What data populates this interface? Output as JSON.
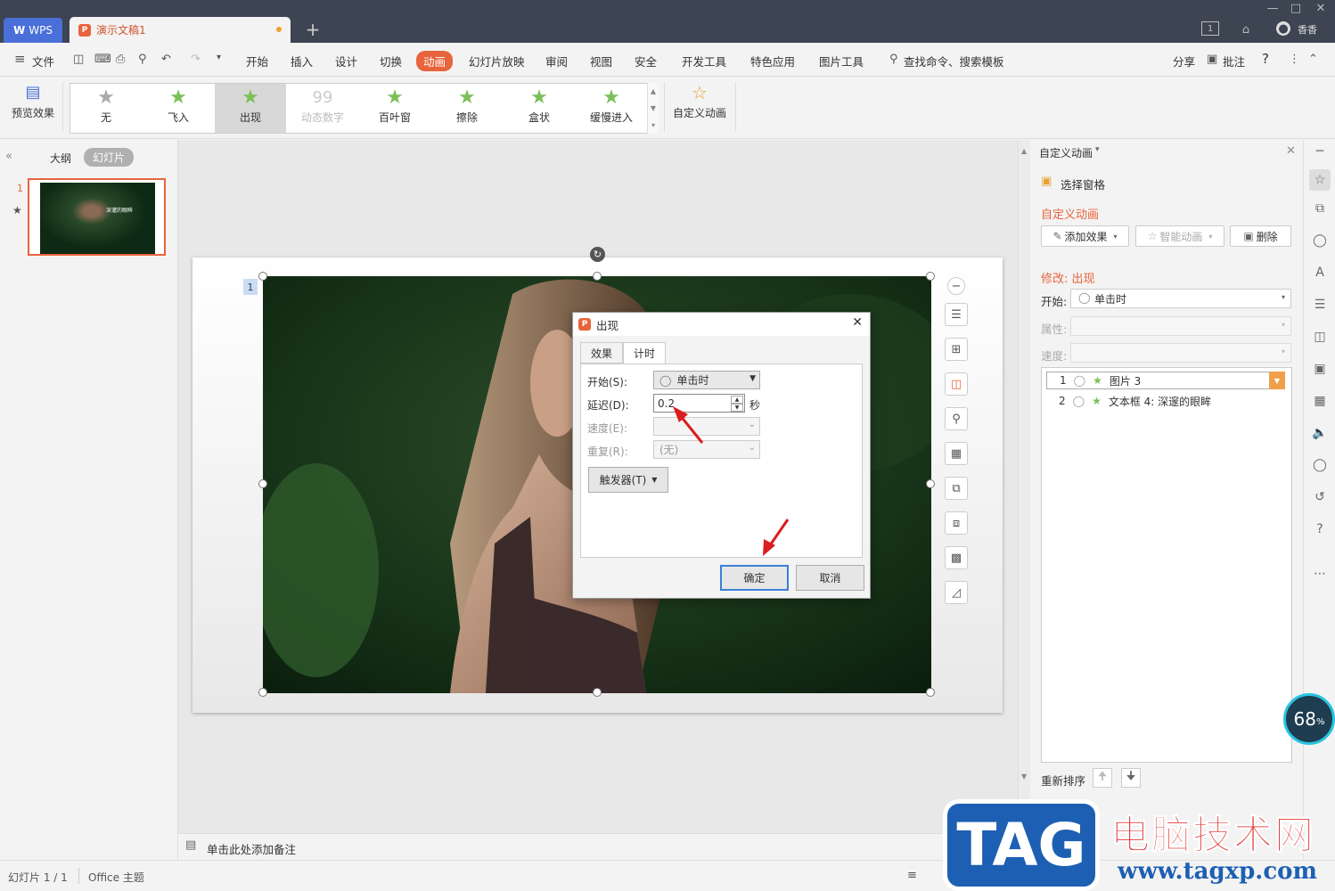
{
  "titlebar": {
    "wps_label": "WPS",
    "doc_tab": "演示文稿1",
    "user": "香香",
    "page_badge": "1"
  },
  "menubar": {
    "file": "文件",
    "items": [
      "开始",
      "插入",
      "设计",
      "切换",
      "动画",
      "幻灯片放映",
      "审阅",
      "视图",
      "安全",
      "开发工具",
      "特色应用",
      "图片工具"
    ],
    "active": "动画",
    "search": "查找命令、搜索模板",
    "share": "分享",
    "comment": "批注",
    "help": "?"
  },
  "ribbon": {
    "preview": "预览效果",
    "effects": [
      {
        "label": "无"
      },
      {
        "label": "飞入"
      },
      {
        "label": "出现"
      },
      {
        "label": "动态数字"
      },
      {
        "label": "百叶窗"
      },
      {
        "label": "擦除"
      },
      {
        "label": "盒状"
      },
      {
        "label": "缓慢进入"
      }
    ],
    "selected_effect": "出现",
    "disabled_effect": "动态数字",
    "custom": "自定义动画"
  },
  "leftpanel": {
    "tab_outline": "大纲",
    "tab_slides": "幻灯片",
    "slide_num": "1",
    "thumb_text": "深邃的眼眸"
  },
  "slide": {
    "anim_badge": "1"
  },
  "notes": {
    "placeholder": "单击此处添加备注"
  },
  "status": {
    "slide_info": "幻灯片 1 / 1",
    "theme": "Office 主题"
  },
  "rightpanel": {
    "title": "自定义动画",
    "selection_pane": "选择窗格",
    "section": "自定义动画",
    "add_effect": "添加效果",
    "smart_anim": "智能动画",
    "delete": "删除",
    "modify": "修改: 出现",
    "start_label": "开始:",
    "start_value": "单击时",
    "prop_label": "属性:",
    "speed_label": "速度:",
    "items": [
      {
        "num": "1",
        "name": "图片 3"
      },
      {
        "num": "2",
        "name": "文本框 4: 深邃的眼眸"
      }
    ],
    "reorder": "重新排序"
  },
  "dialog": {
    "title": "出现",
    "tab_effect": "效果",
    "tab_timing": "计时",
    "start_label": "开始(S):",
    "start_value": "单击时",
    "delay_label": "延迟(D):",
    "delay_value": "0.2",
    "delay_unit": "秒",
    "speed_label": "速度(E):",
    "repeat_label": "重复(R):",
    "repeat_value": "(无)",
    "trigger": "触发器(T)",
    "ok": "确定",
    "cancel": "取消"
  },
  "overlay": {
    "percent": "68",
    "percent_unit": "%",
    "logo_tag": "TAG",
    "logo_cn": "电脑技术网",
    "logo_url": "www.tagxp.com"
  },
  "colors": {
    "accent": "#e8643c",
    "ribbon_star": "#7bbf5a",
    "titlebar": "#3d4452",
    "wps_blue": "#4a6fd8"
  }
}
